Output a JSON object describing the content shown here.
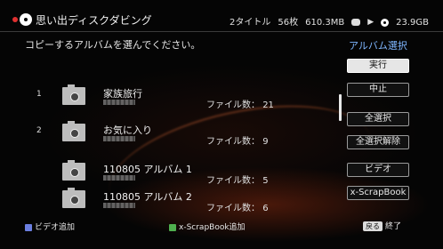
{
  "header": {
    "title": "思い出ディスクダビング",
    "titles_count": "2タイトル",
    "photo_count": "56枚",
    "size": "610.3MB",
    "disc_capacity": "23.9GB"
  },
  "prompt": "コピーするアルバムを選んでください。",
  "section_title": "アルバム選択",
  "albums": [
    {
      "num": "1",
      "name": "家族旅行",
      "count_label": "ファイル数：",
      "count": "21"
    },
    {
      "num": "2",
      "name": "お気に入り",
      "count_label": "ファイル数：",
      "count": "9"
    },
    {
      "num": "",
      "name": "110805 アルバム 1",
      "count_label": "ファイル数：",
      "count": "5"
    },
    {
      "num": "",
      "name": "110805 アルバム 2",
      "count_label": "ファイル数：",
      "count": "6"
    }
  ],
  "buttons": {
    "execute": "実行",
    "cancel": "中止",
    "select_all": "全選択",
    "deselect_all": "全選択解除",
    "video": "ビデオ",
    "scrapbook": "x-ScrapBook"
  },
  "footer": {
    "blue_label": "ビデオ追加",
    "green_label": "x-ScrapBook追加",
    "back_key": "戻る",
    "back_label": "終了"
  },
  "colors": {
    "accent_text": "#7fb6ff",
    "blue_key": "#6b7fe0",
    "green_key": "#4fb04f"
  }
}
